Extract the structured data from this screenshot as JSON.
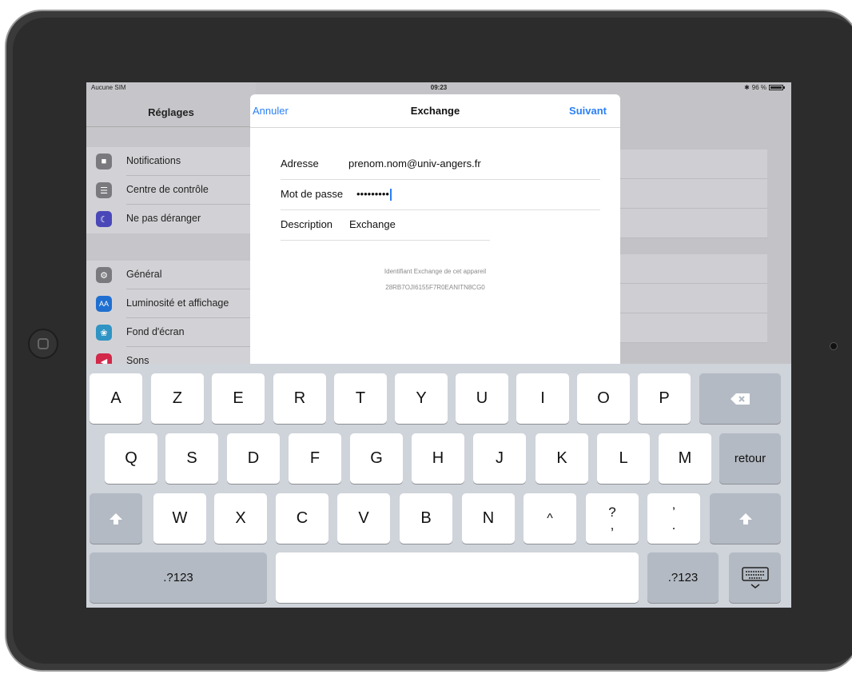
{
  "status_bar": {
    "carrier": "Aucune SIM",
    "time": "09:23",
    "battery": "96 %"
  },
  "settings": {
    "title": "Réglages",
    "group1": [
      {
        "label": "Notifications",
        "icon": "notifications-icon",
        "color": "#8e8e93"
      },
      {
        "label": "Centre de contrôle",
        "icon": "control-center-icon",
        "color": "#8e8e93"
      },
      {
        "label": "Ne pas déranger",
        "icon": "moon-icon",
        "color": "#5856d6"
      }
    ],
    "group2": [
      {
        "label": "Général",
        "icon": "gear-icon",
        "color": "#8e8e93"
      },
      {
        "label": "Luminosité et affichage",
        "icon": "brightness-icon",
        "color": "#007aff"
      },
      {
        "label": "Fond d'écran",
        "icon": "wallpaper-icon",
        "color": "#34aadc"
      },
      {
        "label": "Sons",
        "icon": "speaker-icon",
        "color": "#ff2d55"
      }
    ]
  },
  "sheet": {
    "cancel_label": "Annuler",
    "title": "Exchange",
    "next_label": "Suivant",
    "fields": {
      "address_label": "Adresse",
      "address_value": "prenom.nom@univ-angers.fr",
      "password_label": "Mot de passe",
      "password_value": "•••••••••",
      "description_label": "Description",
      "description_value": "Exchange"
    },
    "device_id_caption": "Identifiant Exchange de cet appareil",
    "device_id": "28RB7OJI6155F7R0EANITN8CG0"
  },
  "keyboard": {
    "row1": [
      "A",
      "Z",
      "E",
      "R",
      "T",
      "Y",
      "U",
      "I",
      "O",
      "P"
    ],
    "row2": [
      "Q",
      "S",
      "D",
      "F",
      "G",
      "H",
      "J",
      "K",
      "L",
      "M"
    ],
    "return_label": "retour",
    "row3": [
      "W",
      "X",
      "C",
      "V",
      "B",
      "N",
      "^"
    ],
    "punct1_top": "?",
    "punct1_bottom": ",",
    "punct2_top": "’",
    "punct2_bottom": ".",
    "numbers_label": ".?123",
    "numbers_label_right": ".?123"
  },
  "colors": {
    "accent": "#2a7ff6"
  }
}
